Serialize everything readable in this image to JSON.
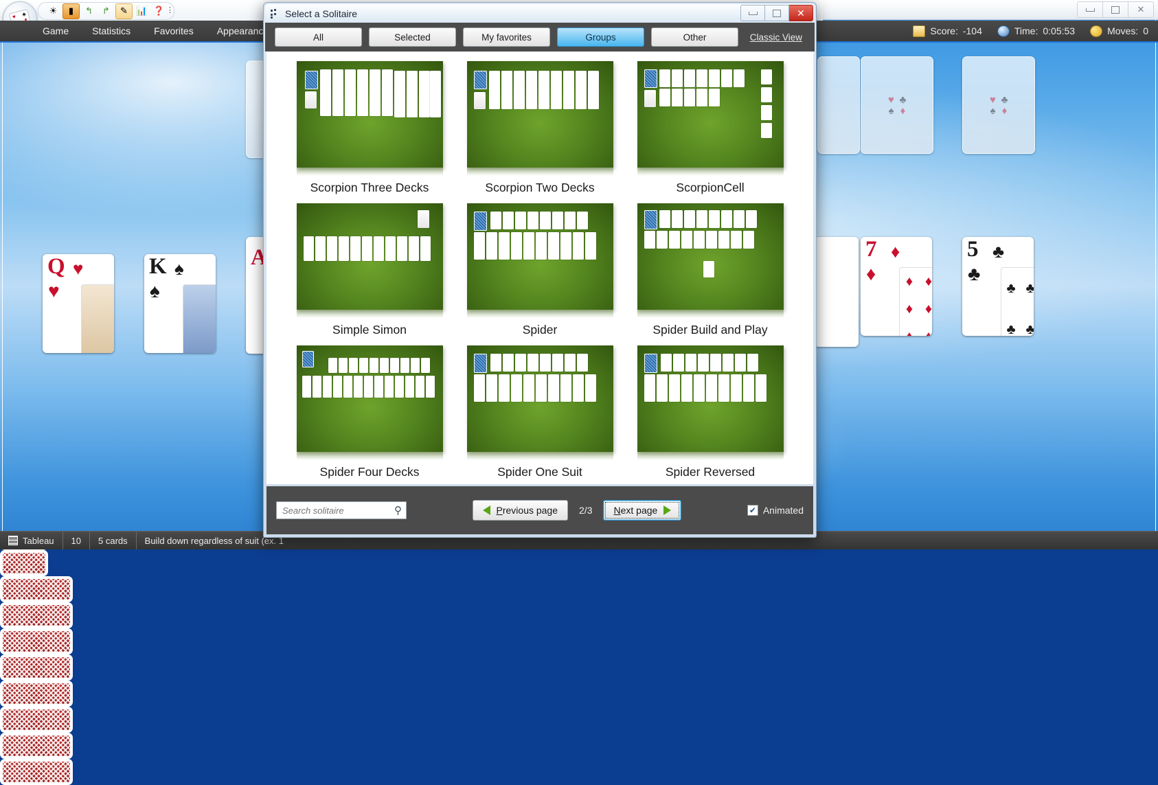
{
  "window": {
    "buttons": [
      {
        "name": "minimize",
        "glyph": "–"
      },
      {
        "name": "maximize",
        "glyph": "□"
      },
      {
        "name": "close",
        "glyph": "✕"
      }
    ]
  },
  "toolbar": {
    "icons": [
      "new-game-icon",
      "deal-icon",
      "undo-icon",
      "redo-icon",
      "hint-icon",
      "statistics-icon",
      "help-icon"
    ],
    "overflow": "⋮"
  },
  "menu": {
    "items": [
      {
        "label": "Game",
        "name": "menu-game"
      },
      {
        "label": "Statistics",
        "name": "menu-statistics"
      },
      {
        "label": "Favorites",
        "name": "menu-favorites"
      },
      {
        "label": "Appearance",
        "name": "menu-appearance"
      }
    ]
  },
  "status": {
    "score_label": "Score:",
    "score_value": "-104",
    "time_label": "Time:",
    "time_value": "0:05:53",
    "moves_label": "Moves:",
    "moves_value": "0"
  },
  "statusbar": {
    "pile": "Tableau",
    "count": "10",
    "cards": "5 cards",
    "rule": "Build down regardless of suit (ex. 1"
  },
  "table_cards": {
    "queen": {
      "rank": "Q",
      "suit": "♥",
      "color": "red"
    },
    "king": {
      "rank": "K",
      "suit": "♠",
      "color": "black"
    },
    "seven": {
      "rank": "7",
      "suit": "♦",
      "color": "red"
    },
    "five": {
      "rank": "5",
      "suit": "♣",
      "color": "black"
    },
    "foundation_suits": [
      "♥",
      "♣",
      "♠",
      "♦"
    ]
  },
  "dialog": {
    "title": "Select a Solitaire",
    "title_icon": "dots-icon",
    "window_buttons": [
      {
        "name": "dialog-minimize",
        "glyph": "–"
      },
      {
        "name": "dialog-maximize",
        "glyph": "□"
      },
      {
        "name": "dialog-close",
        "glyph": "✕"
      }
    ],
    "tabs": [
      {
        "label": "All",
        "name": "tab-all",
        "active": false
      },
      {
        "label": "Selected",
        "name": "tab-selected",
        "active": false
      },
      {
        "label": "My favorites",
        "name": "tab-my-favorites",
        "active": false
      },
      {
        "label": "Groups",
        "name": "tab-groups",
        "active": true
      },
      {
        "label": "Other",
        "name": "tab-other",
        "active": false
      }
    ],
    "classic_view": "Classic View",
    "games": [
      {
        "name": "Scorpion Three Decks",
        "layout": "scorpion3"
      },
      {
        "name": "Scorpion Two Decks",
        "layout": "scorpion2"
      },
      {
        "name": "ScorpionCell",
        "layout": "scorpioncell"
      },
      {
        "name": "Simple Simon",
        "layout": "simplesimon"
      },
      {
        "name": "Spider",
        "layout": "spider"
      },
      {
        "name": "Spider Build and Play",
        "layout": "spiderbuild"
      },
      {
        "name": "Spider Four Decks",
        "layout": "spider4"
      },
      {
        "name": "Spider One Suit",
        "layout": "spider1"
      },
      {
        "name": "Spider Reversed",
        "layout": "spiderrev"
      }
    ],
    "footer": {
      "search_placeholder": "Search solitaire",
      "search_value": "",
      "previous_page": "Previous page",
      "previous_page_mnemonic": "P",
      "next_page": "Next page",
      "next_page_mnemonic": "N",
      "page_indicator": "2/3",
      "animated_label": "Animated",
      "animated_checked": true
    }
  },
  "colors": {
    "accent": "#49b6ef",
    "tabbar": "#4b4b4b",
    "menubar": "#3a3a3a",
    "felt": "#54851f",
    "card_red": "#c8102e",
    "card_black": "#1b1b1b"
  }
}
